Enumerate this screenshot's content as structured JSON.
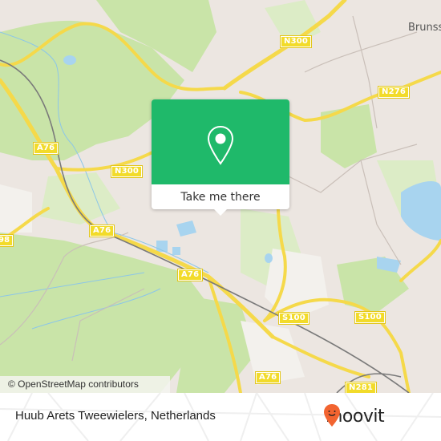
{
  "map": {
    "colors": {
      "background": "#ece6e1",
      "forest": "#c6e3a5",
      "forest_light": "#d8edbe",
      "water": "#a8d4ef",
      "highway": "#f5d94a",
      "railway": "#777777",
      "accent": "#1fb96a"
    },
    "road_labels": [
      {
        "id": "n300-top",
        "text": "N300"
      },
      {
        "id": "n276",
        "text": "N276"
      },
      {
        "id": "a76-left",
        "text": "A76"
      },
      {
        "id": "n300-left",
        "text": "N300"
      },
      {
        "id": "a76-mid",
        "text": "A76"
      },
      {
        "id": "a76-lower",
        "text": "A76"
      },
      {
        "id": "route-98",
        "text": "98"
      },
      {
        "id": "s100-left",
        "text": "S100"
      },
      {
        "id": "s100-right",
        "text": "S100"
      },
      {
        "id": "a76-bottom",
        "text": "A76"
      },
      {
        "id": "n281",
        "text": "N281"
      }
    ],
    "place_labels": [
      {
        "id": "brunssum",
        "text": "Brunss"
      }
    ],
    "attribution": "© OpenStreetMap contributors"
  },
  "popup": {
    "icon": "map-pin-icon",
    "button_label": "Take me there"
  },
  "footer": {
    "place_name": "Huub Arets Tweewielers, Netherlands",
    "brand": "moovit",
    "brand_color": "#f26430"
  }
}
